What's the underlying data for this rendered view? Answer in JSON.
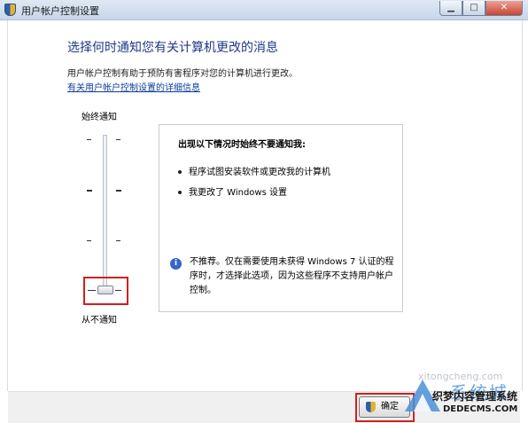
{
  "window": {
    "title": "用户帐户控制设置",
    "minimize_glyph": "▁",
    "maximize_glyph": "□",
    "close_glyph": "✕"
  },
  "header": {
    "heading": "选择何时通知您有关计算机更改的消息",
    "description": "用户帐户控制有助于预防有害程序对您的计算机进行更改。",
    "link": "有关用户帐户控制设置的详细信息"
  },
  "slider": {
    "top_label": "始终通知",
    "bottom_label": "从不通知",
    "levels": 4,
    "selected_level": 1
  },
  "info_box": {
    "title": "出现以下情况时始终不要通知我:",
    "bullets": [
      "程序试图安装软件或更改我的计算机",
      "我更改了 Windows 设置"
    ],
    "info_icon": "info-icon",
    "note": "不推荐。仅在需要使用未获得 Windows 7 认证的程序时，才选择此选项，因为这些程序不支持用户帐户控制。"
  },
  "buttons": {
    "ok_label": "确定"
  },
  "watermark": {
    "domain": "xitongcheng.com",
    "big": "系统城",
    "brand": "织梦内容管理系统",
    "url": "DEDECMS.COM"
  },
  "colors": {
    "heading": "#1e3a8a",
    "link": "#0c3c9c",
    "highlight": "#d0201e"
  }
}
